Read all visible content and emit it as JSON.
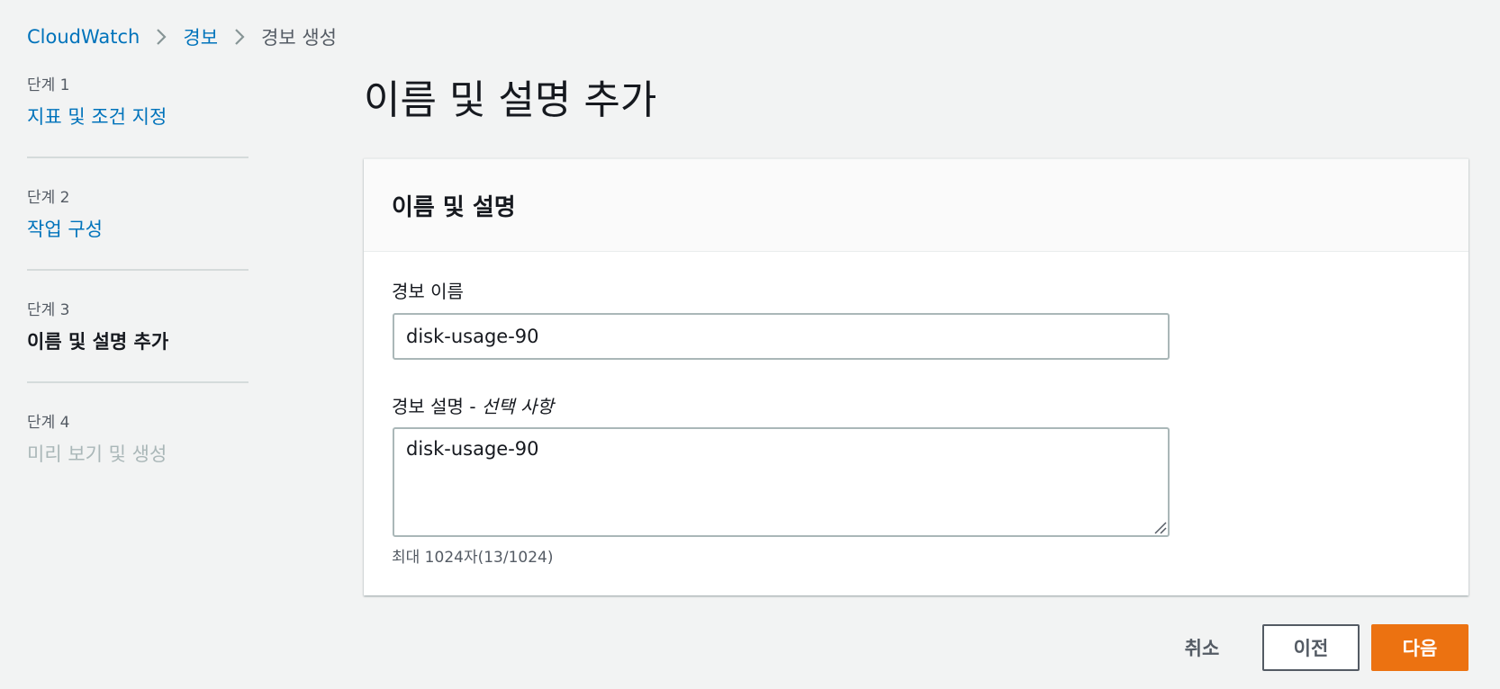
{
  "breadcrumb": {
    "items": [
      {
        "label": "CloudWatch"
      },
      {
        "label": "경보"
      },
      {
        "label": "경보 생성"
      }
    ]
  },
  "wizard": {
    "steps": [
      {
        "number": "단계 1",
        "title": "지표 및 조건 지정",
        "state": "link"
      },
      {
        "number": "단계 2",
        "title": "작업 구성",
        "state": "link"
      },
      {
        "number": "단계 3",
        "title": "이름 및 설명 추가",
        "state": "current"
      },
      {
        "number": "단계 4",
        "title": "미리 보기 및 생성",
        "state": "disabled"
      }
    ]
  },
  "page": {
    "title": "이름 및 설명 추가"
  },
  "panel": {
    "title": "이름 및 설명",
    "name_field": {
      "label": "경보 이름",
      "value": "disk-usage-90"
    },
    "description_field": {
      "label": "경보 설명 - ",
      "optional": "선택 사항",
      "value": "disk-usage-90",
      "hint": "최대 1024자(13/1024)"
    }
  },
  "actions": {
    "cancel_label": "취소",
    "previous_label": "이전",
    "next_label": "다음"
  },
  "colors": {
    "link": "#0073bb",
    "primary_button": "#ec7211",
    "background": "#f2f3f3"
  }
}
